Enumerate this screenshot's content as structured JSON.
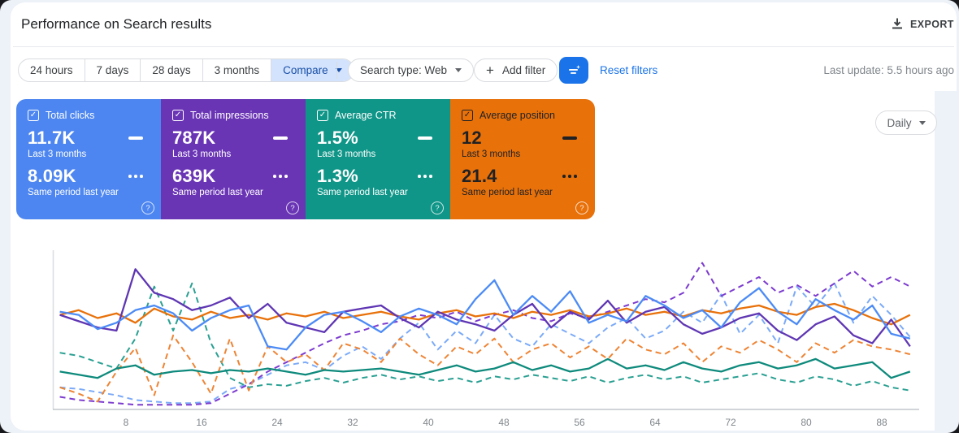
{
  "header": {
    "title": "Performance on Search results",
    "export_label": "EXPORT"
  },
  "filters": {
    "date_ranges": [
      "24 hours",
      "7 days",
      "28 days",
      "3 months"
    ],
    "compare_label": "Compare",
    "search_type_label": "Search type: Web",
    "add_filter_label": "Add filter",
    "reset_label": "Reset filters",
    "last_update": "Last update: 5.5 hours ago"
  },
  "granularity": {
    "selected": "Daily"
  },
  "metric_cards": [
    {
      "label": "Total clicks",
      "current_value": "11.7K",
      "current_label": "Last 3 months",
      "previous_value": "8.09K",
      "previous_label": "Same period last year",
      "color": "#4d86f0",
      "checked": true,
      "help_icon": "?"
    },
    {
      "label": "Total impressions",
      "current_value": "787K",
      "current_label": "Last 3 months",
      "previous_value": "639K",
      "previous_label": "Same period last year",
      "color": "#6a35b5",
      "checked": true,
      "help_icon": "?"
    },
    {
      "label": "Average CTR",
      "current_value": "1.5%",
      "current_label": "Last 3 months",
      "previous_value": "1.3%",
      "previous_label": "Same period last year",
      "color": "#0f9688",
      "checked": true,
      "help_icon": "?"
    },
    {
      "label": "Average position",
      "current_value": "12",
      "current_label": "Last 3 months",
      "previous_value": "21.4",
      "previous_label": "Same period last year",
      "color": "#e8710a",
      "text_color": "#202124",
      "checked": true,
      "help_icon": "?"
    }
  ],
  "chart_data": {
    "type": "line",
    "title": "",
    "x_ticks": [
      8,
      16,
      24,
      32,
      40,
      48,
      56,
      64,
      72,
      80,
      88
    ],
    "x_range": [
      1,
      91
    ],
    "x_unit": "day of 3-month period",
    "sample_step_days": 2,
    "y_axis": "unlabeled; values are normalized 0-100 (% of plot height), each metric auto-scaled",
    "grid": false,
    "legend": "none (colors match metric cards; solid = Last 3 months, dashed = Same period last year)",
    "series": [
      {
        "name": "Clicks — Same period last year",
        "color": "#7baaf8",
        "style": "dashed",
        "values": [
          14,
          13,
          11,
          9,
          6,
          5,
          4,
          4,
          5,
          13,
          16,
          22,
          28,
          30,
          25,
          34,
          40,
          32,
          45,
          55,
          38,
          50,
          42,
          60,
          45,
          40,
          54,
          48,
          42,
          52,
          58,
          45,
          50,
          62,
          55,
          73,
          48,
          60,
          42,
          78,
          65,
          80,
          55,
          72,
          60,
          46
        ]
      },
      {
        "name": "Impressions — Same period last year",
        "color": "#7c3bcf",
        "style": "dashed",
        "values": [
          8,
          6,
          5,
          4,
          3,
          3,
          3,
          3,
          4,
          10,
          16,
          24,
          30,
          36,
          42,
          47,
          50,
          54,
          56,
          60,
          58,
          62,
          56,
          60,
          63,
          58,
          56,
          61,
          58,
          62,
          66,
          70,
          68,
          74,
          93,
          72,
          78,
          84,
          74,
          79,
          72,
          80,
          88,
          78,
          84,
          78
        ]
      },
      {
        "name": "CTR — Same period last year",
        "color": "#2aa092",
        "style": "dashed",
        "values": [
          36,
          34,
          30,
          26,
          45,
          78,
          50,
          80,
          42,
          20,
          14,
          16,
          15,
          18,
          20,
          17,
          20,
          22,
          19,
          21,
          18,
          20,
          17,
          21,
          19,
          22,
          20,
          18,
          21,
          17,
          20,
          22,
          19,
          21,
          17,
          19,
          21,
          23,
          19,
          17,
          21,
          19,
          15,
          18,
          14,
          12
        ]
      },
      {
        "name": "Position — Same period last year",
        "color": "#ee8434",
        "style": "dashed",
        "values": [
          14,
          10,
          5,
          24,
          39,
          9,
          47,
          30,
          10,
          45,
          12,
          40,
          30,
          35,
          25,
          42,
          38,
          30,
          45,
          35,
          28,
          40,
          35,
          45,
          30,
          38,
          42,
          33,
          40,
          32,
          45,
          38,
          35,
          42,
          30,
          40,
          36,
          44,
          38,
          30,
          42,
          36,
          44,
          40,
          38,
          35
        ]
      },
      {
        "name": "CTR — Last 3 months",
        "color": "#0e8a7c",
        "style": "solid",
        "values": [
          24,
          22,
          20,
          26,
          28,
          22,
          24,
          25,
          23,
          25,
          24,
          26,
          24,
          22,
          25,
          24,
          25,
          26,
          24,
          22,
          25,
          28,
          24,
          26,
          30,
          25,
          28,
          24,
          26,
          32,
          26,
          28,
          25,
          30,
          26,
          24,
          28,
          30,
          26,
          28,
          32,
          26,
          28,
          30,
          20,
          24
        ]
      },
      {
        "name": "Position — Last 3 months",
        "color": "#e8710a",
        "style": "solid",
        "values": [
          60,
          63,
          58,
          61,
          55,
          64,
          59,
          57,
          62,
          58,
          60,
          57,
          61,
          59,
          62,
          58,
          60,
          62,
          59,
          57,
          61,
          63,
          59,
          61,
          58,
          62,
          60,
          63,
          59,
          61,
          64,
          60,
          62,
          59,
          63,
          61,
          64,
          66,
          62,
          60,
          65,
          67,
          63,
          58,
          54,
          60
        ]
      },
      {
        "name": "Impressions — Last 3 months",
        "color": "#5f36b3",
        "style": "solid",
        "values": [
          60,
          56,
          52,
          50,
          89,
          74,
          70,
          63,
          66,
          71,
          58,
          67,
          55,
          52,
          49,
          62,
          64,
          66,
          58,
          52,
          62,
          57,
          54,
          50,
          60,
          67,
          52,
          62,
          57,
          69,
          55,
          62,
          65,
          54,
          48,
          52,
          58,
          61,
          50,
          44,
          54,
          59,
          47,
          42,
          57,
          40
        ]
      },
      {
        "name": "Clicks — Last 3 months",
        "color": "#4c8bf5",
        "style": "solid",
        "values": [
          62,
          60,
          51,
          55,
          63,
          66,
          61,
          50,
          58,
          63,
          66,
          40,
          38,
          52,
          60,
          62,
          56,
          49,
          59,
          64,
          60,
          54,
          70,
          82,
          60,
          72,
          62,
          75,
          55,
          60,
          56,
          72,
          66,
          58,
          63,
          52,
          68,
          77,
          62,
          54,
          70,
          63,
          57,
          66,
          48,
          45
        ]
      }
    ]
  }
}
